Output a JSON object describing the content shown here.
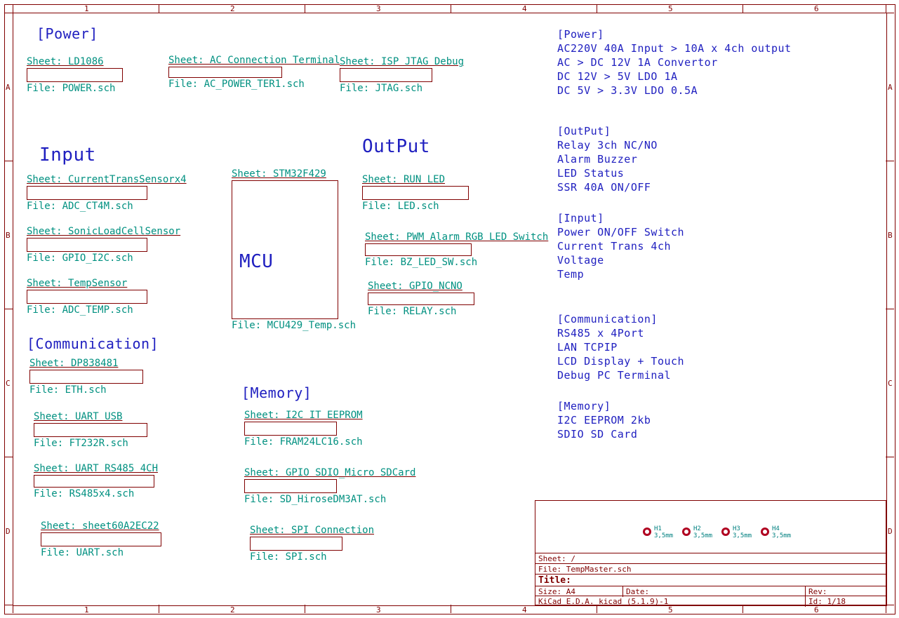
{
  "ruler": {
    "cols": [
      "1",
      "2",
      "3",
      "4",
      "5",
      "6"
    ],
    "rows": [
      "A",
      "B",
      "C",
      "D"
    ]
  },
  "sections": {
    "power": "[Power]",
    "input": "Input",
    "output": "OutPut",
    "comm": "[Communication]",
    "memory": "[Memory]"
  },
  "notes": {
    "power_h": "[Power]",
    "p1": "AC220V 40A Input > 10A x 4ch output",
    "p2": "AC > DC 12V 1A Convertor",
    "p3": "DC 12V > 5V LDO 1A",
    "p4": "DC 5V > 3.3V LDO 0.5A",
    "out_h": "[OutPut]",
    "o1": "Relay 3ch NC/NO",
    "o2": "Alarm Buzzer",
    "o3": "LED Status",
    "o4": "SSR 40A ON/OFF",
    "in_h": "[Input]",
    "i1": "Power ON/OFF Switch",
    "i2": "Current Trans 4ch",
    "i3": "Voltage",
    "i4": "Temp",
    "c_h": "[Communication]",
    "c1": "RS485 x 4Port",
    "c2": "LAN TCPIP",
    "c3": "LCD Display + Touch",
    "c4": "Debug PC Terminal",
    "m_h": "[Memory]",
    "m1": "I2C EEPROM 2kb",
    "m2": "SDIO SD Card"
  },
  "mcu": {
    "top": "Sheet: STM32F429",
    "label": "MCU",
    "bot": "File: MCU429_Temp.sch"
  },
  "sheets": {
    "s1": {
      "t": "Sheet: LD1086",
      "b": "File: POWER.sch"
    },
    "s2": {
      "t": "Sheet: AC Connection Terminal",
      "b": "File: AC_POWER_TER1.sch"
    },
    "s3": {
      "t": "Sheet: ISP JTAG Debug",
      "b": "File: JTAG.sch"
    },
    "s4": {
      "t": "Sheet: CurrentTransSensorx4",
      "b": "File: ADC_CT4M.sch"
    },
    "s5": {
      "t": "Sheet: SonicLoadCellSensor",
      "b": "File: GPIO_I2C.sch"
    },
    "s6": {
      "t": "Sheet: TempSensor",
      "b": "File: ADC_TEMP.sch"
    },
    "s7": {
      "t": "Sheet: RUN LED",
      "b": "File: LED.sch"
    },
    "s8": {
      "t": "Sheet: PWM Alarm RGB LED Switch",
      "b": "File: BZ_LED_SW.sch"
    },
    "s9": {
      "t": "Sheet: GPIO_NCNO",
      "b": "File: RELAY.sch"
    },
    "s10": {
      "t": "Sheet: DP838481",
      "b": "File: ETH.sch"
    },
    "s11": {
      "t": "Sheet: UART USB",
      "b": "File: FT232R.sch"
    },
    "s12": {
      "t": "Sheet: UART RS485 4CH",
      "b": "File: RS485x4.sch"
    },
    "s13": {
      "t": "Sheet: sheet60A2EC22",
      "b": "File: UART.sch"
    },
    "s14": {
      "t": "Sheet: I2C IT EEPROM",
      "b": "File: FRAM24LC16.sch"
    },
    "s15": {
      "t": "Sheet: GPIO SDIO_Micro SDCard",
      "b": "File: SD_HiroseDM3AT.sch"
    },
    "s16": {
      "t": "Sheet: SPI Connection",
      "b": "File: SPI.sch"
    }
  },
  "holes": {
    "h1": "H1",
    "h2": "H2",
    "h3": "H3",
    "h4": "H4",
    "mm": "3,5mm"
  },
  "title": {
    "sheet": "Sheet: /",
    "file": "File: TempMaster.sch",
    "title": "Title:",
    "size": "Size: A4",
    "date": "Date:",
    "rev": "Rev:",
    "kicad": "KiCad E.D.A.  kicad (5.1.9)-1",
    "id": "Id: 1/18"
  }
}
